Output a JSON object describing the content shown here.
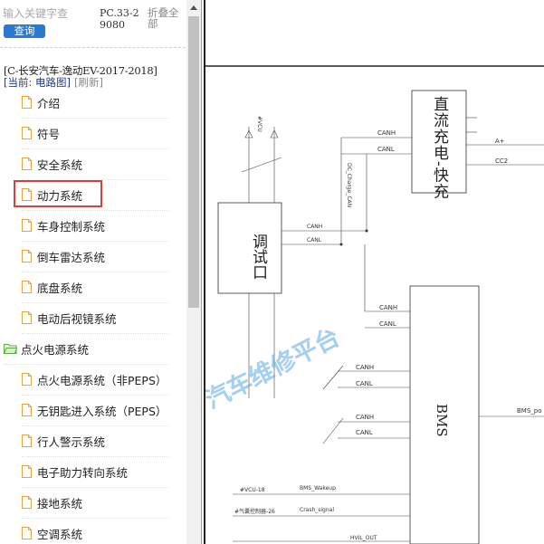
{
  "search": {
    "placeholder": "输入关键字查",
    "button_label": "查询"
  },
  "header": {
    "pc_code": "PC.33-29080",
    "collapse_all": "折叠全部"
  },
  "vehicle": {
    "title": "[C-长安汽车-逸动EV-2017-2018]",
    "current": "[当前: 电路图]",
    "refresh": "[刷新]"
  },
  "tree": {
    "items": [
      {
        "label": "介绍",
        "type": "doc"
      },
      {
        "label": "符号",
        "type": "doc"
      },
      {
        "label": "安全系统",
        "type": "doc"
      },
      {
        "label": "动力系统",
        "type": "doc",
        "selected": true
      },
      {
        "label": "车身控制系统",
        "type": "doc"
      },
      {
        "label": "倒车雷达系统",
        "type": "doc"
      },
      {
        "label": "底盘系统",
        "type": "doc"
      },
      {
        "label": "电动后视镜系统",
        "type": "doc"
      },
      {
        "label": "点火电源系统",
        "type": "folder"
      },
      {
        "label": "点火电源系统（非PEPS）",
        "type": "doc"
      },
      {
        "label": "无钥匙进入系统（PEPS）",
        "type": "doc"
      },
      {
        "label": "行人警示系统",
        "type": "doc"
      },
      {
        "label": "电子助力转向系统",
        "type": "doc"
      },
      {
        "label": "接地系统",
        "type": "doc"
      },
      {
        "label": "空调系统",
        "type": "doc"
      }
    ]
  },
  "diagram": {
    "dc_charger": "直流充电-快充",
    "debug_port": "调试口",
    "bms": "BMS",
    "watermark": "汽车维修平台",
    "labels": {
      "canh": "CANH",
      "canl": "CANL",
      "a_plus": "A+",
      "cc2": "CC2",
      "vcu": "#VCU",
      "dc_charge_can": "DC_Charge_CAN",
      "bms_wakeup": "BMS_Wakeup",
      "crash_signal": "Crash_signal",
      "vcu_18": "#VCU-18",
      "hvil_out": "HVIL_OUT",
      "bms_po": "BMS_po",
      "airbag_26": "#气囊控制器-26"
    }
  },
  "colors": {
    "accent": "#2a7ad2",
    "selected_border": "#d9403a",
    "doc_icon": "#e8a33c",
    "folder_icon": "#5aa846"
  }
}
